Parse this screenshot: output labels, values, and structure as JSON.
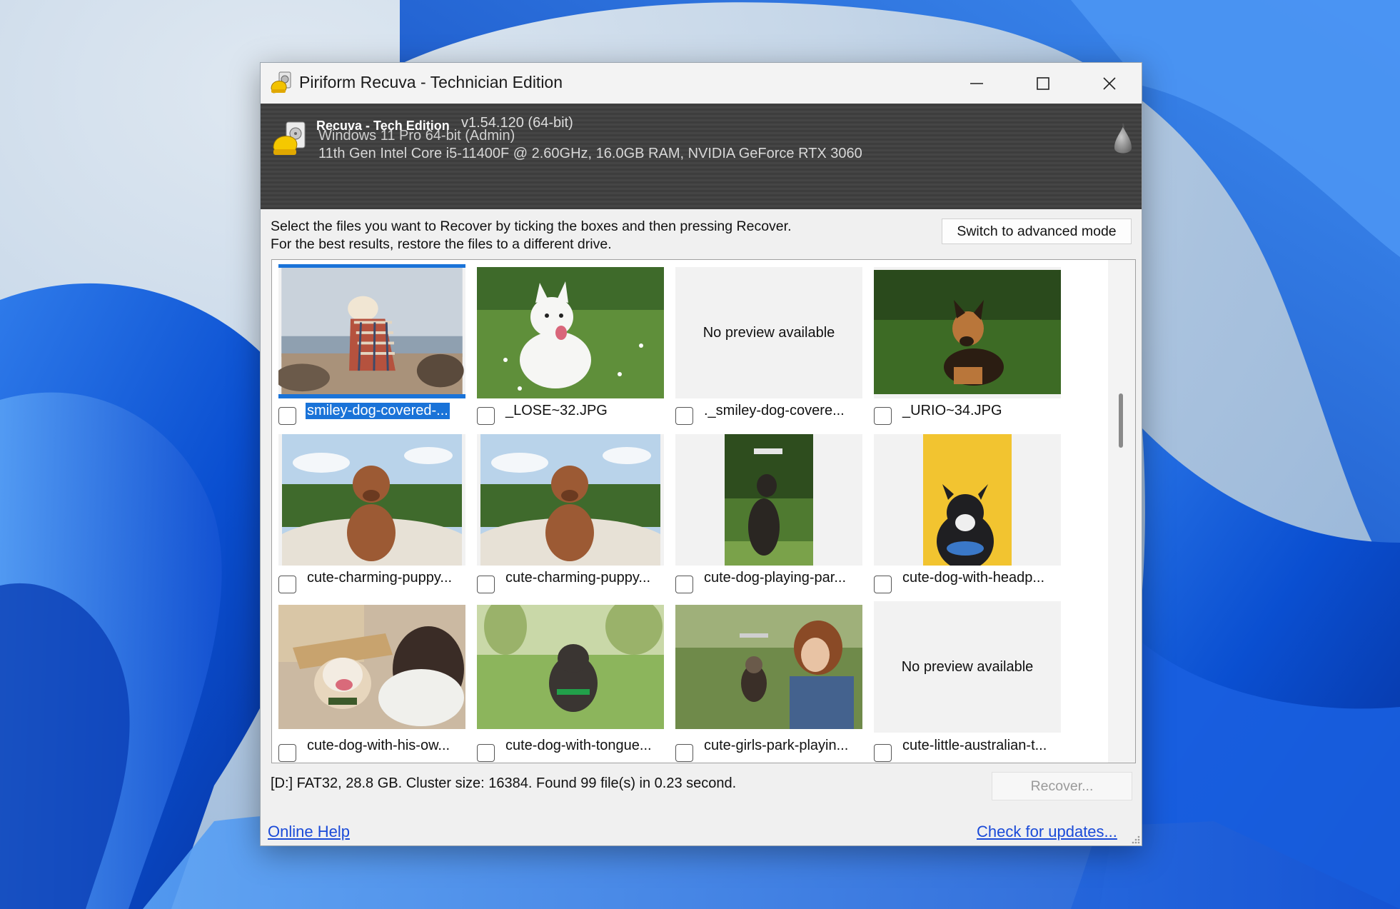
{
  "window": {
    "title": "Piriform Recuva - Technician Edition",
    "controls": {
      "minimize": "minimize",
      "maximize": "maximize",
      "close": "close"
    }
  },
  "header": {
    "product_name": "Recuva - Tech Edition",
    "version": "v1.54.120 (64-bit)",
    "os": "Windows 11 Pro 64-bit (Admin)",
    "hardware": "11th Gen Intel Core i5-11400F @ 2.60GHz, 16.0GB RAM, NVIDIA GeForce RTX 3060"
  },
  "instructions": {
    "line1": "Select the files you want to Recover by ticking the boxes and then pressing Recover.",
    "line2": "For the best results, restore the files to a different drive."
  },
  "advanced_button": "Switch to advanced mode",
  "files": [
    {
      "name": "smiley-dog-covered-...",
      "preview": "smiley-dog-covered-blanket",
      "selected": true,
      "checked": false
    },
    {
      "name": "_LOSE~32.JPG",
      "preview": "white-shepherd-dog",
      "selected": false,
      "checked": false
    },
    {
      "name": "._smiley-dog-covere...",
      "preview": "none",
      "selected": false,
      "checked": false
    },
    {
      "name": "_URIO~34.JPG",
      "preview": "german-shepherd-puppy",
      "selected": false,
      "checked": false
    },
    {
      "name": "cute-charming-puppy...",
      "preview": "brown-puppy-on-blanket",
      "selected": false,
      "checked": false
    },
    {
      "name": "cute-charming-puppy...",
      "preview": "brown-puppy-on-blanket",
      "selected": false,
      "checked": false
    },
    {
      "name": "cute-dog-playing-par...",
      "preview": "dog-playing-park",
      "selected": false,
      "checked": false
    },
    {
      "name": "cute-dog-with-headp...",
      "preview": "dog-with-headphones-yellow",
      "selected": false,
      "checked": false
    },
    {
      "name": "cute-dog-with-his-ow...",
      "preview": "dog-with-owner-table",
      "selected": false,
      "checked": false
    },
    {
      "name": "cute-dog-with-tongue...",
      "preview": "small-dog-on-grass",
      "selected": false,
      "checked": false
    },
    {
      "name": "cute-girls-park-playin...",
      "preview": "girl-with-small-dog",
      "selected": false,
      "checked": false
    },
    {
      "name": "cute-little-australian-t...",
      "preview": "none",
      "selected": false,
      "checked": false
    }
  ],
  "no_preview_text": "No preview available",
  "status": "[D:] FAT32, 28.8 GB. Cluster size: 16384. Found 99 file(s) in 0.23 second.",
  "recover_button": "Recover...",
  "links": {
    "help": "Online Help",
    "updates": "Check for updates..."
  }
}
